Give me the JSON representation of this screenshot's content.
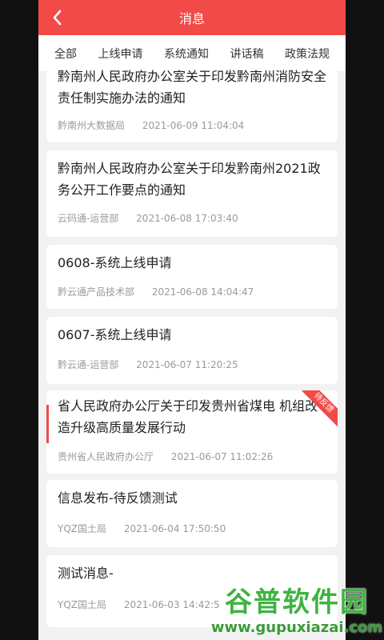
{
  "header": {
    "title": "消息"
  },
  "tabs": [
    {
      "label": "全部",
      "active": true
    },
    {
      "label": "上线申请"
    },
    {
      "label": "系统通知"
    },
    {
      "label": "讲话稿"
    },
    {
      "label": "政策法规"
    }
  ],
  "messages": [
    {
      "title": "黔南州人民政府办公室关于印发黔南州消防安全责任制实施办法的通知",
      "source": "黔南州大数据局",
      "time": "2021-06-09 11:04:04"
    },
    {
      "title": "黔南州人民政府办公室关于印发黔南州2021政务公开工作要点的通知",
      "source": "云码通-运营部",
      "time": "2021-06-08 17:03:40"
    },
    {
      "title": "0608-系统上线申请",
      "source": "黔云通产品技术部",
      "time": "2021-06-08 14:04:47"
    },
    {
      "title": "0607-系统上线申请",
      "source": "黔云通-运营部",
      "time": "2021-06-07 11:20:25"
    },
    {
      "title": "省人民政府办公厅关于印发贵州省煤电 机组改造升级高质量发展行动",
      "source": "贵州省人民政府办公厅",
      "time": "2021-06-07 11:02:26",
      "badge": "待反馈"
    },
    {
      "title": "信息发布-待反馈测试",
      "source": "YQZ国土局",
      "time": "2021-06-04 17:50:50"
    },
    {
      "title": "测试消息-",
      "source": "YQZ国土局",
      "time": "2021-06-03 14:42:5"
    }
  ],
  "watermark": {
    "line1": "谷普软件园",
    "line2": "www.gupuxiazai.com"
  },
  "colors": {
    "accent": "#f24a47"
  }
}
